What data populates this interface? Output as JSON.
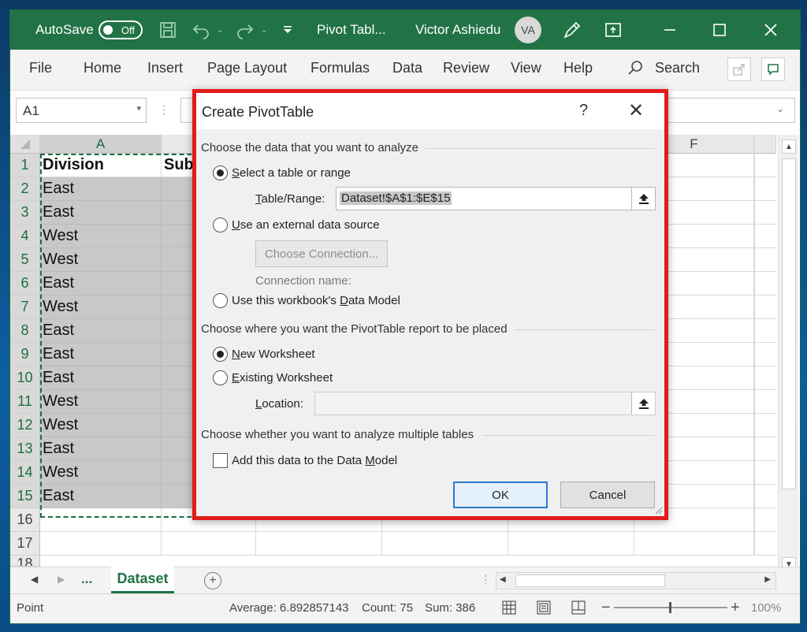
{
  "titlebar": {
    "autosave_label": "AutoSave",
    "autosave_state": "Off",
    "doc_title": "Pivot Tabl...",
    "user_name": "Victor Ashiedu",
    "user_initials": "VA",
    "icons": [
      "save-icon",
      "undo-icon",
      "redo-icon",
      "customize-icon",
      "pen-icon",
      "ribbon-display-icon",
      "minimize-icon",
      "maximize-icon",
      "close-icon"
    ]
  },
  "ribbon": {
    "tabs": [
      "File",
      "Home",
      "Insert",
      "Page Layout",
      "Formulas",
      "Data",
      "Review",
      "View",
      "Help"
    ],
    "search_label": "Search"
  },
  "formula_bar": {
    "name_box": "A1"
  },
  "grid": {
    "columns": [
      "A",
      "F"
    ],
    "rows": [
      "1",
      "2",
      "3",
      "4",
      "5",
      "6",
      "7",
      "8",
      "9",
      "10",
      "11",
      "12",
      "13",
      "14",
      "15",
      "16",
      "17",
      "18"
    ],
    "col_a": [
      "Division",
      "East",
      "East",
      "West",
      "West",
      "East",
      "West",
      "East",
      "East",
      "East",
      "West",
      "West",
      "East",
      "West",
      "East"
    ],
    "col_b_header": "Sub"
  },
  "sheets": {
    "nav_ellipsis": "...",
    "active": "Dataset"
  },
  "status": {
    "mode": "Point",
    "average": "Average: 6.892857143",
    "count": "Count: 75",
    "sum": "Sum: 386",
    "zoom": "100%"
  },
  "dialog": {
    "title": "Create PivotTable",
    "help": "?",
    "section1": "Choose the data that you want to analyze",
    "opt_table": {
      "u": "S",
      "rest": "elect a table or range",
      "selected": true
    },
    "table_range_label_u": "T",
    "table_range_label_rest": "able/Range:",
    "table_range_value": "Dataset!$A$1:$E$15",
    "opt_external": {
      "u": "U",
      "rest": "se an external data source",
      "selected": false
    },
    "choose_connection": "Choose Connection...",
    "connection_name": "Connection name:",
    "opt_model_pre": "Use this workbook's ",
    "opt_model_u": "D",
    "opt_model_post": "ata Model",
    "section2": "Choose where you want the PivotTable report to be placed",
    "opt_new": {
      "u": "N",
      "rest": "ew Worksheet",
      "selected": true
    },
    "opt_existing": {
      "u": "E",
      "rest": "xisting Worksheet",
      "selected": false
    },
    "location_u": "L",
    "location_rest": "ocation:",
    "location_value": "",
    "section3": "Choose whether you want to analyze multiple tables",
    "add_model_pre": "Add this data to the Data ",
    "add_model_u": "M",
    "add_model_post": "odel",
    "add_model_checked": false,
    "ok": "OK",
    "cancel": "Cancel"
  },
  "colors": {
    "excel_green": "#217346",
    "highlight_red": "#e21b1b",
    "primary_border": "#2b79d1"
  }
}
